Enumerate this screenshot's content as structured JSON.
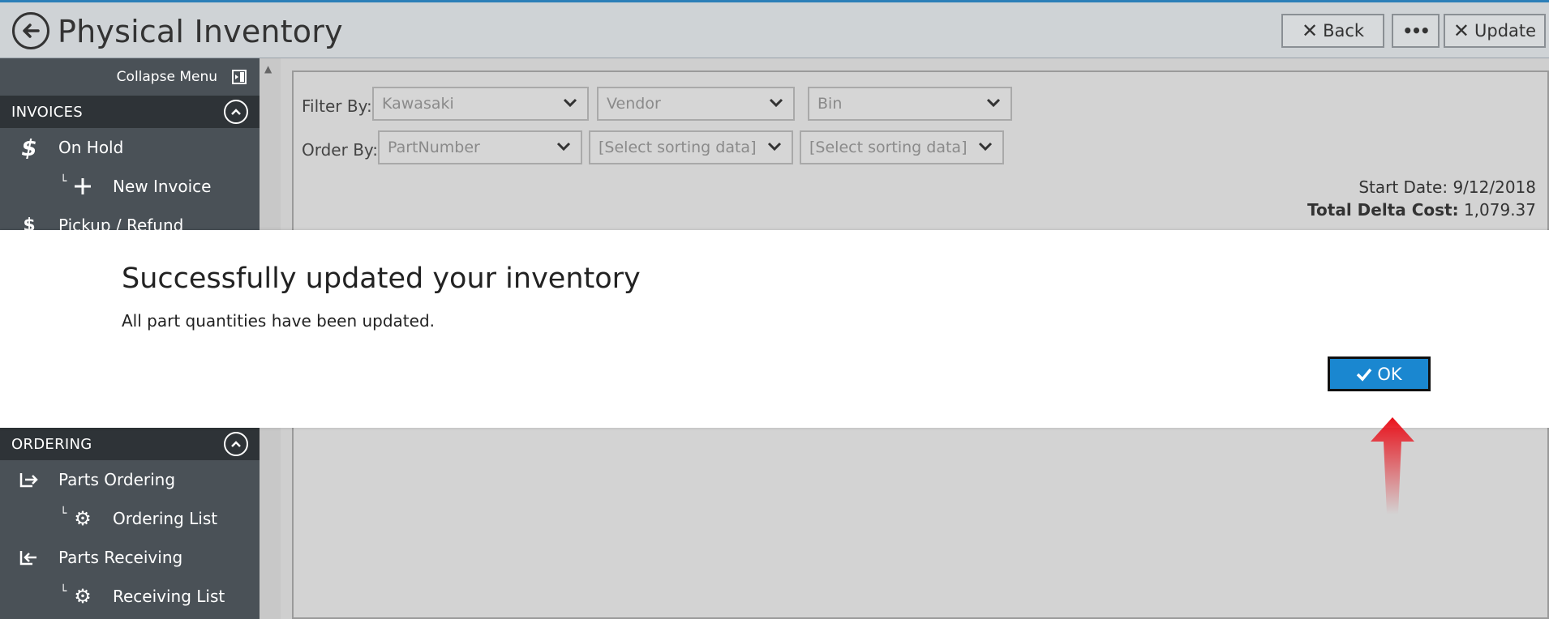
{
  "header": {
    "title": "Physical Inventory",
    "back_label": "Back",
    "more_label": "•••",
    "update_label": "Update"
  },
  "sidebar": {
    "collapse_label": "Collapse Menu",
    "sections": [
      {
        "title": "INVOICES",
        "items": [
          {
            "label": "On Hold",
            "icon": "dollar-icon"
          },
          {
            "label": "New Invoice",
            "icon": "plus-icon",
            "sub": true
          },
          {
            "label": "Pickup / Refund",
            "icon": "refund-icon"
          }
        ]
      },
      {
        "title": "ORDERING",
        "items": [
          {
            "label": "Parts Ordering",
            "icon": "parts-out-icon"
          },
          {
            "label": "Ordering List",
            "icon": "gear-icon",
            "sub": true
          },
          {
            "label": "Parts Receiving",
            "icon": "parts-in-icon"
          },
          {
            "label": "Receiving List",
            "icon": "gear-icon",
            "sub": true
          }
        ]
      }
    ]
  },
  "filters": {
    "filter_label": "Filter By:",
    "filter_values": [
      "Kawasaki",
      "Vendor",
      "Bin"
    ],
    "order_label": "Order By:",
    "order_values": [
      "PartNumber",
      "[Select sorting data]",
      "[Select sorting data]"
    ]
  },
  "info": {
    "start_date_label": "Start Date:",
    "start_date_value": "9/12/2018",
    "delta_label": "Total Delta Cost:",
    "delta_value": "1,079.37"
  },
  "modal": {
    "title": "Successfully updated your inventory",
    "message": "All part quantities have been updated.",
    "ok_label": "OK"
  },
  "colors": {
    "accent": "#1a87d0",
    "sidebar": "#4a5157",
    "annotation": "#e8101a"
  }
}
